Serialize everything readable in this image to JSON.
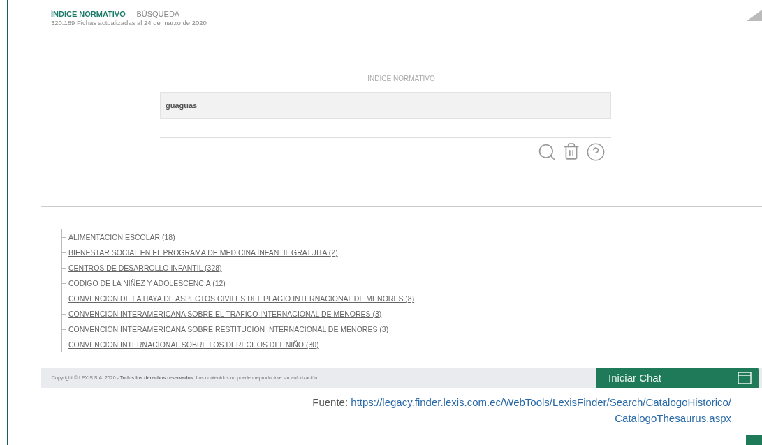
{
  "header": {
    "title": "ÍNDICE NORMATIVO",
    "separator": "-",
    "section": "BÚSQUEDA",
    "subtitle": "320.189 Fichas actualizadas al 24 de marzo de 2020"
  },
  "search": {
    "label": "INDICE NORMATIVO",
    "value": "guaguas"
  },
  "results": [
    {
      "label": "ALIMENTACION ESCOLAR (18)"
    },
    {
      "label": "BIENESTAR SOCIAL EN EL PROGRAMA DE MEDICINA INFANTIL GRATUITA (2)"
    },
    {
      "label": "CENTROS DE DESARROLLO INFANTIL (328)"
    },
    {
      "label": "CODIGO DE LA NIÑEZ Y ADOLESCENCIA (12)"
    },
    {
      "label": "CONVENCION DE LA HAYA DE ASPECTOS CIVILES DEL PLAGIO INTERNACIONAL DE MENORES (8)"
    },
    {
      "label": "CONVENCION INTERAMERICANA SOBRE EL TRAFICO INTERNACIONAL DE MENORES (3)"
    },
    {
      "label": "CONVENCION INTERAMERICANA SOBRE RESTITUCION INTERNACIONAL DE MENORES (3)"
    },
    {
      "label": "CONVENCION INTERNACIONAL SOBRE LOS DERECHOS DEL NIÑO (30)"
    }
  ],
  "footer": {
    "copyright": "Copyright © LEXIS S.A. 2020 - **Todos los derechos reservados**. Los contenidos no pueden reproducirse sin autorización.",
    "chat_button": "Iniciar Chat"
  },
  "caption": {
    "prefix": "Fuente:",
    "link_line_1": "https://legacy.finder.lexis.com.ec/WebTools/LexisFinder/Search/CatalogoHistorico/",
    "link_line_2": "CatalogoThesaurus.aspx"
  }
}
